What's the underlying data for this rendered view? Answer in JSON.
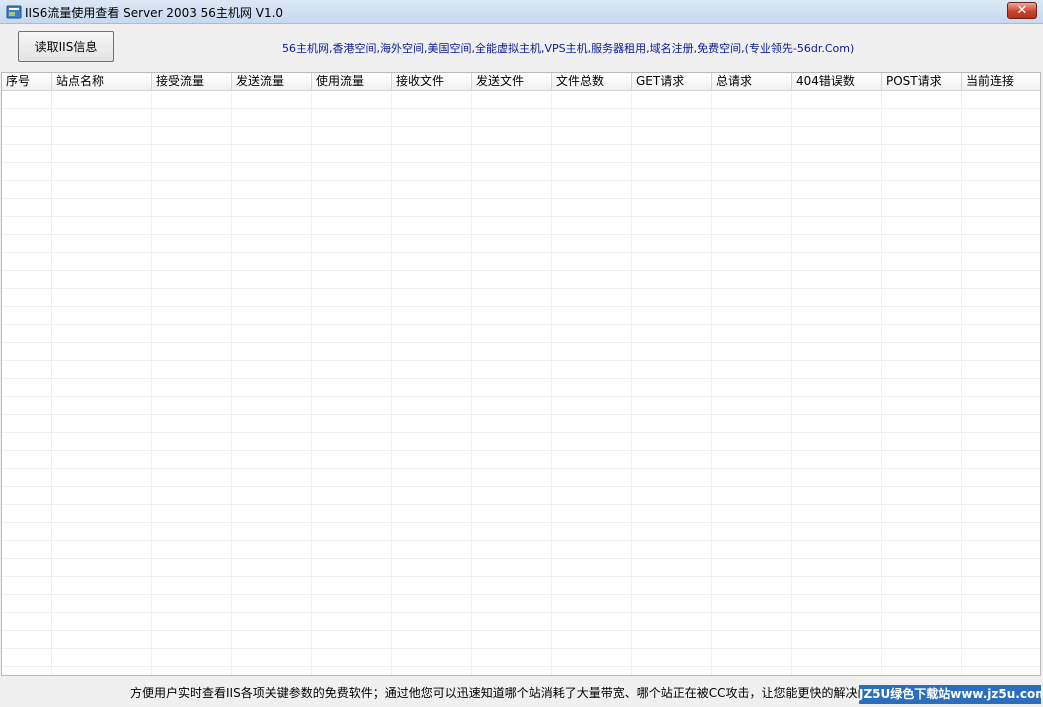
{
  "window": {
    "title": "IIS6流量使用查看 Server 2003 56主机网 V1.0",
    "close_glyph": "✕"
  },
  "toolbar": {
    "read_button_label": "读取IIS信息",
    "ad_text": "56主机网,香港空间,海外空间,美国空间,全能虚拟主机,VPS主机,服务器租用,域名注册,免费空间,(专业领先-56dr.Com)"
  },
  "table": {
    "columns": [
      {
        "label": "序号"
      },
      {
        "label": "站点名称"
      },
      {
        "label": "接受流量"
      },
      {
        "label": "发送流量"
      },
      {
        "label": "使用流量"
      },
      {
        "label": "接收文件"
      },
      {
        "label": "发送文件"
      },
      {
        "label": "文件总数"
      },
      {
        "label": "GET请求"
      },
      {
        "label": "总请求"
      },
      {
        "label": "404错误数"
      },
      {
        "label": "POST请求"
      },
      {
        "label": "当前连接"
      }
    ],
    "rows": []
  },
  "status": {
    "text": "方便用户实时查看IIS各项关键参数的免费软件；通过他您可以迅速知道哪个站消耗了大量带宽、哪个站正在被CC攻击，让您能更快的解决问题",
    "watermark": "JZ5U绿色下载站www.jz5u.com"
  },
  "colors": {
    "ad_text": "#0a1a9a",
    "watermark_bg": "#2a6fbf",
    "close_button": "#c9452c"
  }
}
